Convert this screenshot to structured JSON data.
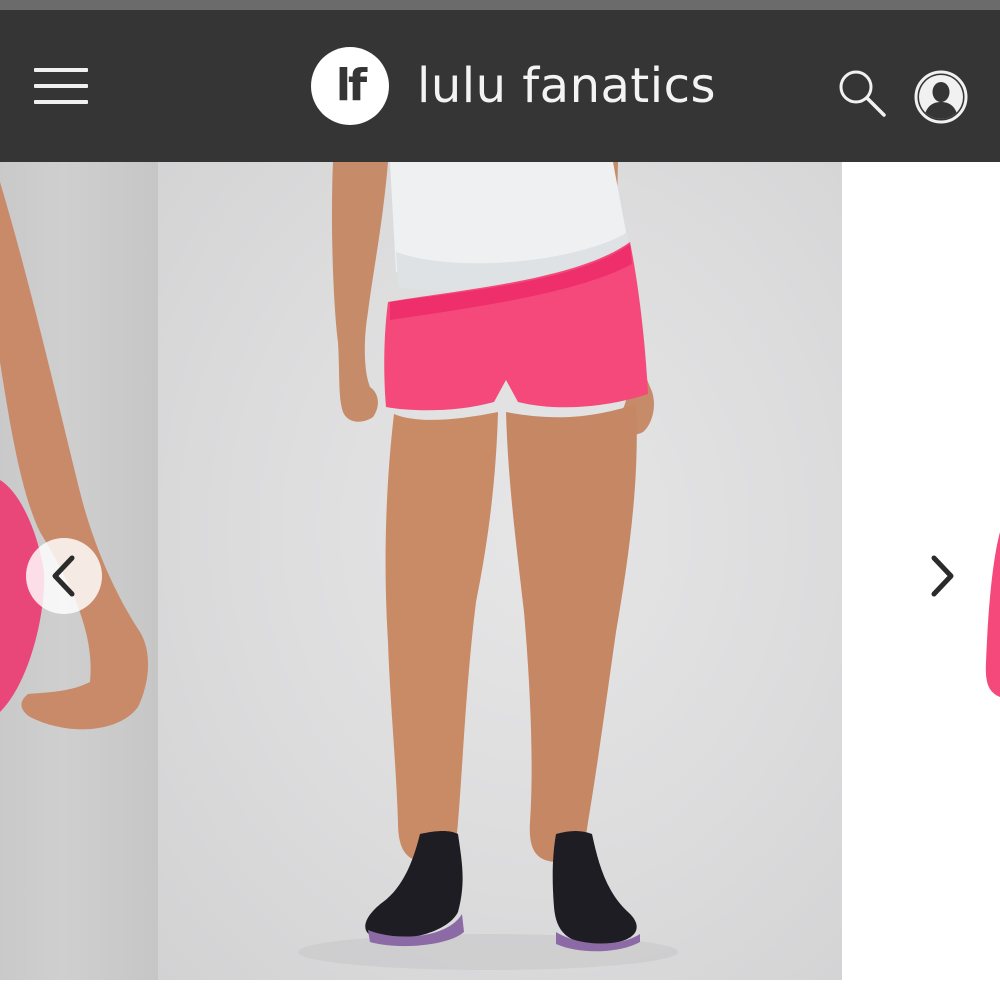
{
  "header": {
    "menu_icon": "hamburger-menu-icon",
    "logo_text": "lf",
    "brand_name": "lulu fanatics",
    "search_icon": "search-icon",
    "account_icon": "user-account-icon",
    "background_color": "#353535"
  },
  "carousel": {
    "prev_icon": "chevron-left-icon",
    "next_icon": "chevron-right-icon",
    "main_image": "product-photo-pink-running-shorts",
    "product_color": "#f4497a"
  }
}
